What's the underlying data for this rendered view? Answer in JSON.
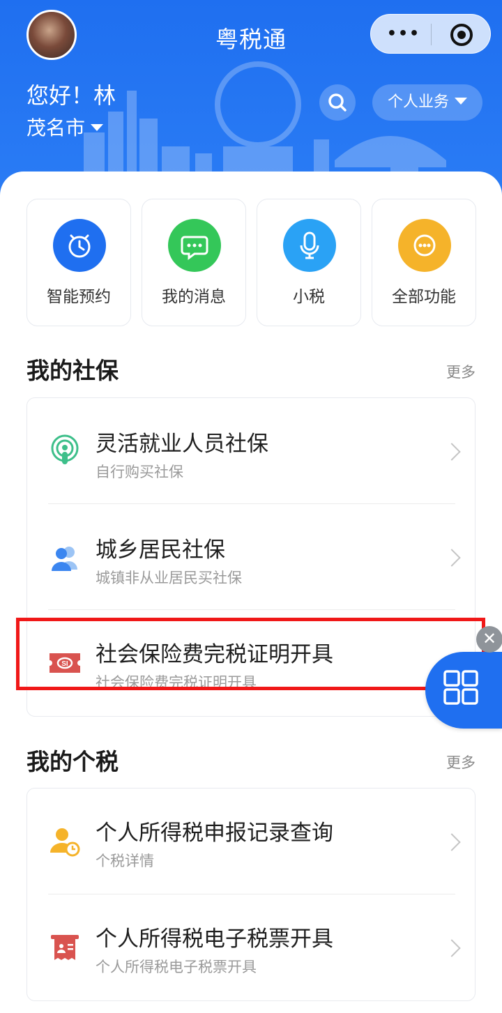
{
  "header": {
    "app_title": "粤税通",
    "greeting": "您好！林",
    "city": "茂名市",
    "business_button": "个人业务",
    "capsule_dots": "•••"
  },
  "quick_actions": [
    {
      "label": "智能预约",
      "icon": "alarm-clock-icon",
      "color": "#1f6ff0"
    },
    {
      "label": "我的消息",
      "icon": "chat-bubble-icon",
      "color": "#34c759"
    },
    {
      "label": "小税",
      "icon": "microphone-icon",
      "color": "#2aa2f5"
    },
    {
      "label": "全部功能",
      "icon": "more-dots-icon",
      "color": "#f5b32a"
    }
  ],
  "social_insurance": {
    "title": "我的社保",
    "more": "更多",
    "items": [
      {
        "title": "灵活就业人员社保",
        "subtitle": "自行购买社保",
        "icon": "person-signal-icon"
      },
      {
        "title": "城乡居民社保",
        "subtitle": "城镇非从业居民买社保",
        "icon": "users-icon"
      },
      {
        "title": "社会保险费完税证明开具",
        "subtitle": "社会保险费完税证明开具",
        "icon": "si-ticket-icon"
      }
    ]
  },
  "personal_tax": {
    "title": "我的个税",
    "more": "更多",
    "items": [
      {
        "title": "个人所得税申报记录查询",
        "subtitle": "个税详情",
        "icon": "person-clock-icon"
      },
      {
        "title": "个人所得税电子税票开具",
        "subtitle": "个人所得税电子税票开具",
        "icon": "receipt-icon"
      }
    ]
  },
  "float": {
    "close_symbol": "✕"
  }
}
